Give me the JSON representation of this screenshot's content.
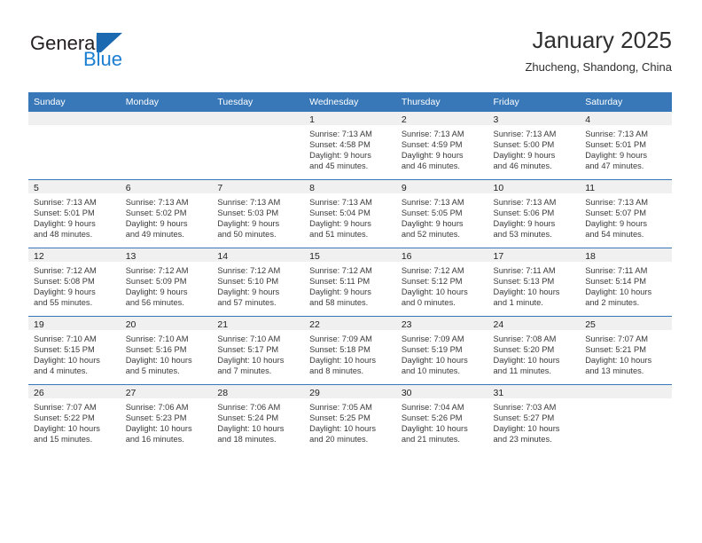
{
  "brand": {
    "name_part1": "General",
    "name_part2": "Blue",
    "accent_color": "#1b7fd1",
    "triangle_color": "#1b69b0"
  },
  "header": {
    "title": "January 2025",
    "subtitle": "Zhucheng, Shandong, China"
  },
  "theme": {
    "header_row_bg": "#3878b8",
    "daynum_band_bg": "#f0f0f0",
    "row_border": "#3878b8"
  },
  "weekdays": [
    "Sunday",
    "Monday",
    "Tuesday",
    "Wednesday",
    "Thursday",
    "Friday",
    "Saturday"
  ],
  "labels": {
    "sunrise_prefix": "Sunrise:",
    "sunset_prefix": "Sunset:",
    "daylight_prefix": "Daylight:"
  },
  "weeks": [
    [
      {
        "day": "",
        "empty": true
      },
      {
        "day": "",
        "empty": true
      },
      {
        "day": "",
        "empty": true
      },
      {
        "day": "1",
        "sunrise": "Sunrise: 7:13 AM",
        "sunset": "Sunset: 4:58 PM",
        "daylight_line1": "Daylight: 9 hours",
        "daylight_line2": "and 45 minutes."
      },
      {
        "day": "2",
        "sunrise": "Sunrise: 7:13 AM",
        "sunset": "Sunset: 4:59 PM",
        "daylight_line1": "Daylight: 9 hours",
        "daylight_line2": "and 46 minutes."
      },
      {
        "day": "3",
        "sunrise": "Sunrise: 7:13 AM",
        "sunset": "Sunset: 5:00 PM",
        "daylight_line1": "Daylight: 9 hours",
        "daylight_line2": "and 46 minutes."
      },
      {
        "day": "4",
        "sunrise": "Sunrise: 7:13 AM",
        "sunset": "Sunset: 5:01 PM",
        "daylight_line1": "Daylight: 9 hours",
        "daylight_line2": "and 47 minutes."
      }
    ],
    [
      {
        "day": "5",
        "sunrise": "Sunrise: 7:13 AM",
        "sunset": "Sunset: 5:01 PM",
        "daylight_line1": "Daylight: 9 hours",
        "daylight_line2": "and 48 minutes."
      },
      {
        "day": "6",
        "sunrise": "Sunrise: 7:13 AM",
        "sunset": "Sunset: 5:02 PM",
        "daylight_line1": "Daylight: 9 hours",
        "daylight_line2": "and 49 minutes."
      },
      {
        "day": "7",
        "sunrise": "Sunrise: 7:13 AM",
        "sunset": "Sunset: 5:03 PM",
        "daylight_line1": "Daylight: 9 hours",
        "daylight_line2": "and 50 minutes."
      },
      {
        "day": "8",
        "sunrise": "Sunrise: 7:13 AM",
        "sunset": "Sunset: 5:04 PM",
        "daylight_line1": "Daylight: 9 hours",
        "daylight_line2": "and 51 minutes."
      },
      {
        "day": "9",
        "sunrise": "Sunrise: 7:13 AM",
        "sunset": "Sunset: 5:05 PM",
        "daylight_line1": "Daylight: 9 hours",
        "daylight_line2": "and 52 minutes."
      },
      {
        "day": "10",
        "sunrise": "Sunrise: 7:13 AM",
        "sunset": "Sunset: 5:06 PM",
        "daylight_line1": "Daylight: 9 hours",
        "daylight_line2": "and 53 minutes."
      },
      {
        "day": "11",
        "sunrise": "Sunrise: 7:13 AM",
        "sunset": "Sunset: 5:07 PM",
        "daylight_line1": "Daylight: 9 hours",
        "daylight_line2": "and 54 minutes."
      }
    ],
    [
      {
        "day": "12",
        "sunrise": "Sunrise: 7:12 AM",
        "sunset": "Sunset: 5:08 PM",
        "daylight_line1": "Daylight: 9 hours",
        "daylight_line2": "and 55 minutes."
      },
      {
        "day": "13",
        "sunrise": "Sunrise: 7:12 AM",
        "sunset": "Sunset: 5:09 PM",
        "daylight_line1": "Daylight: 9 hours",
        "daylight_line2": "and 56 minutes."
      },
      {
        "day": "14",
        "sunrise": "Sunrise: 7:12 AM",
        "sunset": "Sunset: 5:10 PM",
        "daylight_line1": "Daylight: 9 hours",
        "daylight_line2": "and 57 minutes."
      },
      {
        "day": "15",
        "sunrise": "Sunrise: 7:12 AM",
        "sunset": "Sunset: 5:11 PM",
        "daylight_line1": "Daylight: 9 hours",
        "daylight_line2": "and 58 minutes."
      },
      {
        "day": "16",
        "sunrise": "Sunrise: 7:12 AM",
        "sunset": "Sunset: 5:12 PM",
        "daylight_line1": "Daylight: 10 hours",
        "daylight_line2": "and 0 minutes."
      },
      {
        "day": "17",
        "sunrise": "Sunrise: 7:11 AM",
        "sunset": "Sunset: 5:13 PM",
        "daylight_line1": "Daylight: 10 hours",
        "daylight_line2": "and 1 minute."
      },
      {
        "day": "18",
        "sunrise": "Sunrise: 7:11 AM",
        "sunset": "Sunset: 5:14 PM",
        "daylight_line1": "Daylight: 10 hours",
        "daylight_line2": "and 2 minutes."
      }
    ],
    [
      {
        "day": "19",
        "sunrise": "Sunrise: 7:10 AM",
        "sunset": "Sunset: 5:15 PM",
        "daylight_line1": "Daylight: 10 hours",
        "daylight_line2": "and 4 minutes."
      },
      {
        "day": "20",
        "sunrise": "Sunrise: 7:10 AM",
        "sunset": "Sunset: 5:16 PM",
        "daylight_line1": "Daylight: 10 hours",
        "daylight_line2": "and 5 minutes."
      },
      {
        "day": "21",
        "sunrise": "Sunrise: 7:10 AM",
        "sunset": "Sunset: 5:17 PM",
        "daylight_line1": "Daylight: 10 hours",
        "daylight_line2": "and 7 minutes."
      },
      {
        "day": "22",
        "sunrise": "Sunrise: 7:09 AM",
        "sunset": "Sunset: 5:18 PM",
        "daylight_line1": "Daylight: 10 hours",
        "daylight_line2": "and 8 minutes."
      },
      {
        "day": "23",
        "sunrise": "Sunrise: 7:09 AM",
        "sunset": "Sunset: 5:19 PM",
        "daylight_line1": "Daylight: 10 hours",
        "daylight_line2": "and 10 minutes."
      },
      {
        "day": "24",
        "sunrise": "Sunrise: 7:08 AM",
        "sunset": "Sunset: 5:20 PM",
        "daylight_line1": "Daylight: 10 hours",
        "daylight_line2": "and 11 minutes."
      },
      {
        "day": "25",
        "sunrise": "Sunrise: 7:07 AM",
        "sunset": "Sunset: 5:21 PM",
        "daylight_line1": "Daylight: 10 hours",
        "daylight_line2": "and 13 minutes."
      }
    ],
    [
      {
        "day": "26",
        "sunrise": "Sunrise: 7:07 AM",
        "sunset": "Sunset: 5:22 PM",
        "daylight_line1": "Daylight: 10 hours",
        "daylight_line2": "and 15 minutes."
      },
      {
        "day": "27",
        "sunrise": "Sunrise: 7:06 AM",
        "sunset": "Sunset: 5:23 PM",
        "daylight_line1": "Daylight: 10 hours",
        "daylight_line2": "and 16 minutes."
      },
      {
        "day": "28",
        "sunrise": "Sunrise: 7:06 AM",
        "sunset": "Sunset: 5:24 PM",
        "daylight_line1": "Daylight: 10 hours",
        "daylight_line2": "and 18 minutes."
      },
      {
        "day": "29",
        "sunrise": "Sunrise: 7:05 AM",
        "sunset": "Sunset: 5:25 PM",
        "daylight_line1": "Daylight: 10 hours",
        "daylight_line2": "and 20 minutes."
      },
      {
        "day": "30",
        "sunrise": "Sunrise: 7:04 AM",
        "sunset": "Sunset: 5:26 PM",
        "daylight_line1": "Daylight: 10 hours",
        "daylight_line2": "and 21 minutes."
      },
      {
        "day": "31",
        "sunrise": "Sunrise: 7:03 AM",
        "sunset": "Sunset: 5:27 PM",
        "daylight_line1": "Daylight: 10 hours",
        "daylight_line2": "and 23 minutes."
      },
      {
        "day": "",
        "empty": true
      }
    ]
  ]
}
